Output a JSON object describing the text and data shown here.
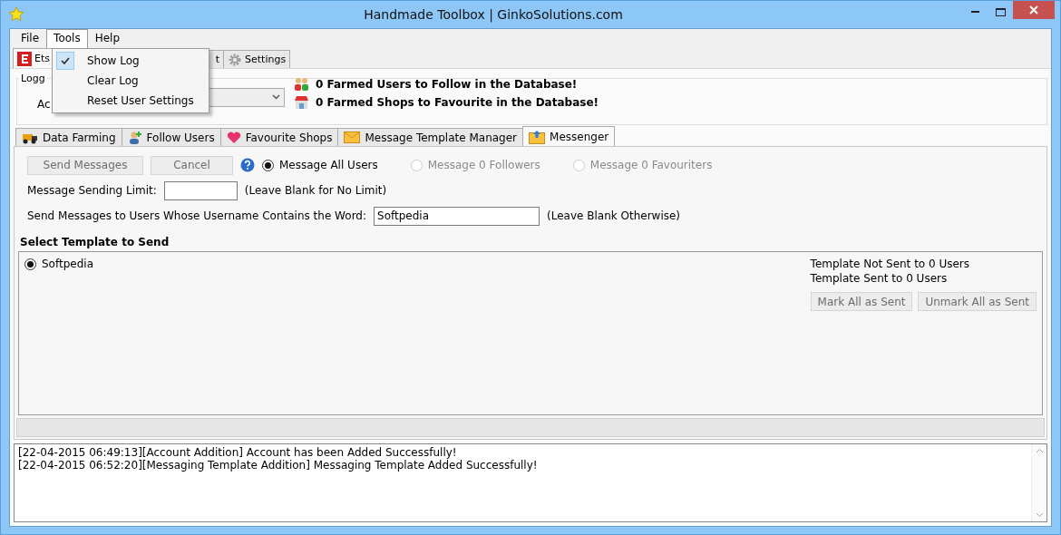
{
  "window": {
    "title": "Handmade Toolbox  |  GinkoSolutions.com"
  },
  "menu_bar": [
    {
      "label": "File",
      "selected": false
    },
    {
      "label": "Tools",
      "selected": true
    },
    {
      "label": "Help",
      "selected": false
    }
  ],
  "tools_menu": [
    {
      "label": "Show Log",
      "checked": true
    },
    {
      "label": "Clear Log",
      "checked": false
    },
    {
      "label": "Reset User Settings",
      "checked": false
    }
  ],
  "top_tabs": [
    {
      "label": "Ets",
      "selected": true
    },
    {
      "label": "t",
      "selected": false
    },
    {
      "label": "Settings",
      "selected": false
    }
  ],
  "account_group": {
    "label": "Logg",
    "field_label": "Ac"
  },
  "stats": [
    "0 Farmed Users to Follow in the Database!",
    "0 Farmed Shops to Favourite in the Database!"
  ],
  "inner_tabs": [
    {
      "label": "Data Farming",
      "selected": false
    },
    {
      "label": "Follow Users",
      "selected": false
    },
    {
      "label": "Favourite Shops",
      "selected": false
    },
    {
      "label": "Message Template Manager",
      "selected": false
    },
    {
      "label": "Messenger",
      "selected": true
    }
  ],
  "messenger": {
    "buttons": [
      {
        "label": "Send Messages",
        "disabled": true
      },
      {
        "label": "Cancel",
        "disabled": true
      }
    ],
    "targets": [
      {
        "label": "Message All Users",
        "selected": true,
        "disabled": false
      },
      {
        "label": "Message 0 Followers",
        "selected": false,
        "disabled": true
      },
      {
        "label": "Message 0 Favouriters",
        "selected": false,
        "disabled": true
      }
    ],
    "limit": {
      "label": "Message Sending Limit:",
      "hint": "(Leave Blank for No Limit)"
    },
    "word_filter": {
      "label": "Send Messages to Users Whose Username Contains the Word:",
      "value": "Softpedia",
      "hint": "(Leave Blank Otherwise)"
    },
    "template_title": "Select Template to Send",
    "templates": [
      {
        "label": "Softpedia",
        "selected": true
      }
    ],
    "counts": [
      "Template Not Sent to 0 Users",
      "Template Sent to 0 Users"
    ],
    "mark_buttons": [
      {
        "label": "Mark All as Sent",
        "disabled": true
      },
      {
        "label": "Unmark All as Sent",
        "disabled": true
      }
    ]
  },
  "log": [
    "[22-04-2015 06:49:13][Account Addition] Account has been Added Successfully!",
    "[22-04-2015 06:52:20][Messaging Template Addition] Messaging Template Added Successfully!"
  ]
}
